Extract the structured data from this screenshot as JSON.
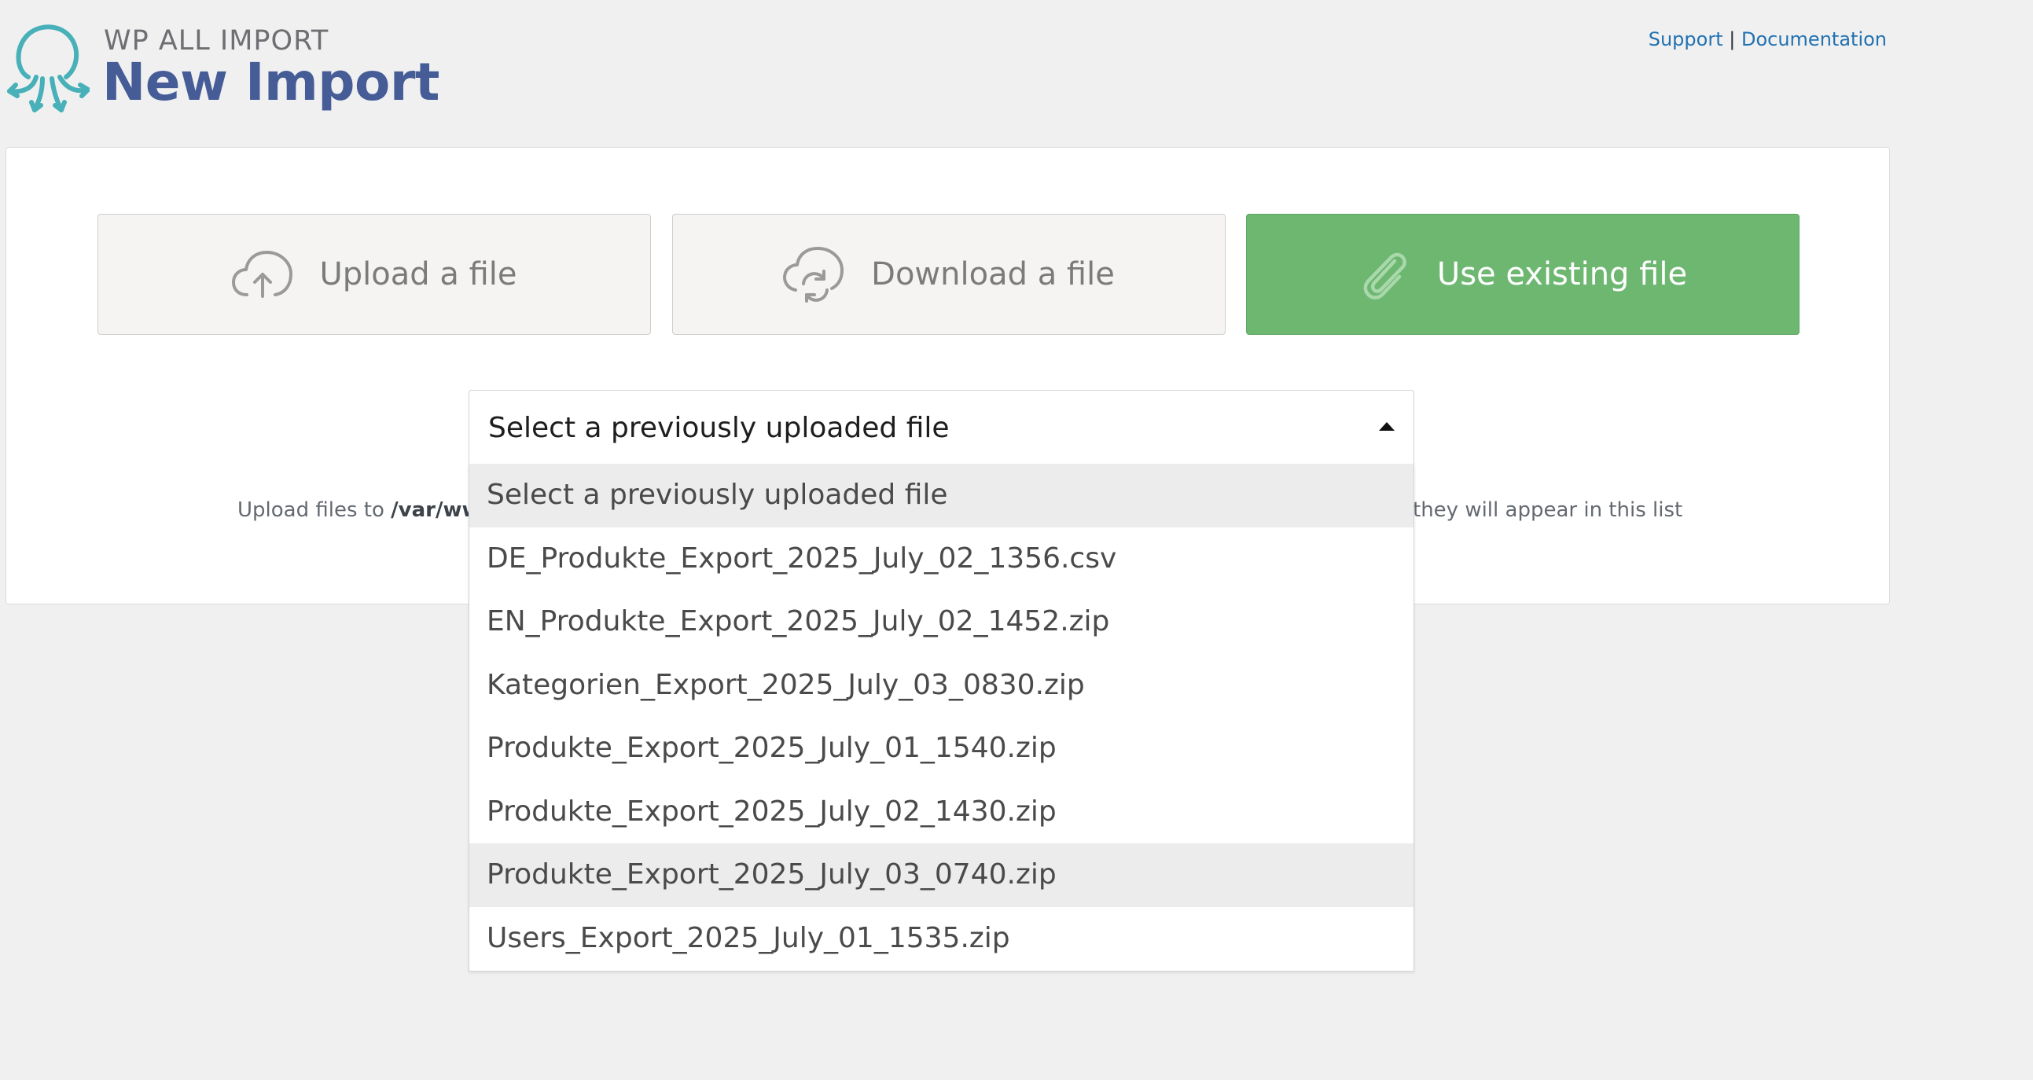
{
  "header": {
    "brand": "WP ALL IMPORT",
    "title": "New Import",
    "support_link": "Support",
    "separator": "|",
    "docs_link": "Documentation"
  },
  "options": {
    "upload": "Upload a file",
    "download": "Download a file",
    "existing": "Use existing file"
  },
  "select": {
    "value": "Select a previously uploaded file"
  },
  "hint": {
    "prefix": "Upload files to",
    "path_fragment": "/var/www",
    "suffix": "they will appear in this list"
  },
  "dropdown": {
    "items": [
      "Select a previously uploaded file",
      "DE_Produkte_Export_2025_July_02_1356.csv",
      "EN_Produkte_Export_2025_July_02_1452.zip",
      "Kategorien_Export_2025_July_03_0830.zip",
      "Produkte_Export_2025_July_01_1540.zip",
      "Produkte_Export_2025_July_02_1430.zip",
      "Produkte_Export_2025_July_03_0740.zip",
      "Users_Export_2025_July_01_1535.zip"
    ],
    "selected_index": 0,
    "hover_index": 6
  },
  "colors": {
    "accent_green": "#6db771",
    "brand_blue": "#455c97",
    "logo_teal": "#48b0b8",
    "link_blue": "#2271b1"
  },
  "icons": {
    "logo": "octopus-logo",
    "upload": "cloud-upload-icon",
    "download": "cloud-sync-icon",
    "existing": "paperclip-icon"
  }
}
